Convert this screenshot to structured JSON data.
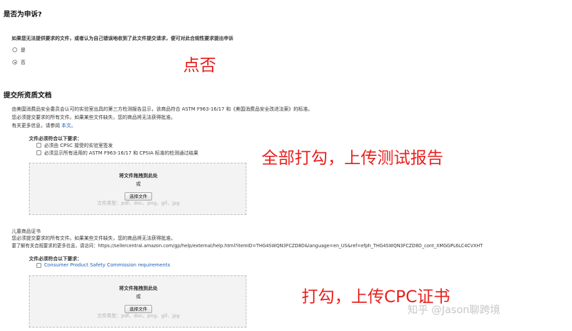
{
  "appeal": {
    "heading": "是否为申诉?",
    "question": "如果您无法提供要求的文件，或者认为自己错误地收到了此文件提交请求，便可对此合规性要求提出申诉",
    "option_yes": "是",
    "option_no": "否"
  },
  "qualification": {
    "heading": "提交所资质文档",
    "line1": "由美国消费品安全委员会认可的实验室出具的第三方检测报告显示，该商品符合 ASTM F963-16/17 和《美国消费品安全改进法案》的标准。",
    "line2": "您必须提交要求的所有文件。如果某些文件缺失，您的商品将无法获得批准。",
    "line3_prefix": "有关更多信息，请参阅",
    "line3_link": "本文。",
    "req_title": "文件必须符合以下要求：",
    "req1": "必须由 CPSC 接受的实验室签发",
    "req2": "必须显示所有适用的 ASTM F963-16/17 和 CPSIA 标准的检测通过结果"
  },
  "upload1": {
    "drag_label": "将文件拖拽到此处",
    "or_label": "或",
    "button_label": "选择文件",
    "file_types": "文件类型：pdf、doc、png、gif、jpg"
  },
  "children_cert": {
    "heading": "儿童商品证书",
    "line1": "您必须提交要求的所有文件。如果某些文件缺失，您的商品将无法获得批准。",
    "line2": "要了解有关合规要求的更多信息，请访问：https://sellercentral.amazon.com/gp/help/external/help.html?itemID=THG4SWQN3FCZD8D&language=en_US&ref=efph_THG4SWQN3FCZD8D_cont_XMGGPL6LC4CVXHT",
    "req_title": "文件必须符合以下要求：",
    "req1": "Consumer Product Safety Commission requirements"
  },
  "upload2": {
    "drag_label": "将文件拖拽到此处",
    "or_label": "或",
    "button_label": "选择文件",
    "file_types": "文件类型：pdf、doc、png、gif、jpg"
  },
  "annotations": {
    "note1": "点否",
    "note2": "全部打勾，上传测试报告",
    "note3": "打勾，上传CPC证书"
  },
  "watermark": "知乎 @Jason聊跨境",
  "colors": {
    "annotation_red": "#e8201f",
    "link_blue": "#1a5fb4"
  }
}
